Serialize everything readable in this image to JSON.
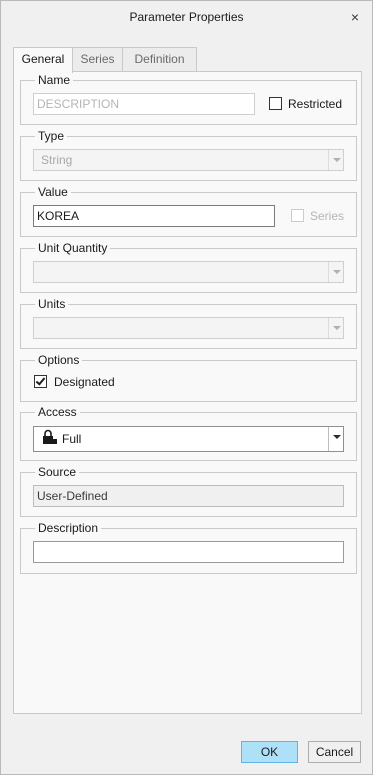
{
  "window": {
    "title": "Parameter Properties",
    "close_glyph": "×"
  },
  "tabs": [
    {
      "label": "General",
      "active": true
    },
    {
      "label": "Series",
      "active": false
    },
    {
      "label": "Definition",
      "active": false
    }
  ],
  "name": {
    "legend": "Name",
    "placeholder": "DESCRIPTION",
    "restricted_label": "Restricted",
    "restricted_checked": false
  },
  "type": {
    "legend": "Type",
    "selected": "String"
  },
  "value": {
    "legend": "Value",
    "text": "KOREA",
    "series_label": "Series",
    "series_checked": false
  },
  "unit_quantity": {
    "legend": "Unit Quantity",
    "selected": ""
  },
  "units": {
    "legend": "Units",
    "selected": ""
  },
  "options": {
    "legend": "Options",
    "designated_label": "Designated",
    "designated_checked": true
  },
  "access": {
    "legend": "Access",
    "selected": "Full",
    "icon": "lock-icon"
  },
  "source": {
    "legend": "Source",
    "value": "User-Defined"
  },
  "description": {
    "legend": "Description",
    "value": ""
  },
  "buttons": {
    "ok": "OK",
    "cancel": "Cancel"
  },
  "colors": {
    "ok_button": "#aee0f8",
    "window_bg": "#f0f0f0",
    "panel_bg": "#f9f9f9"
  }
}
